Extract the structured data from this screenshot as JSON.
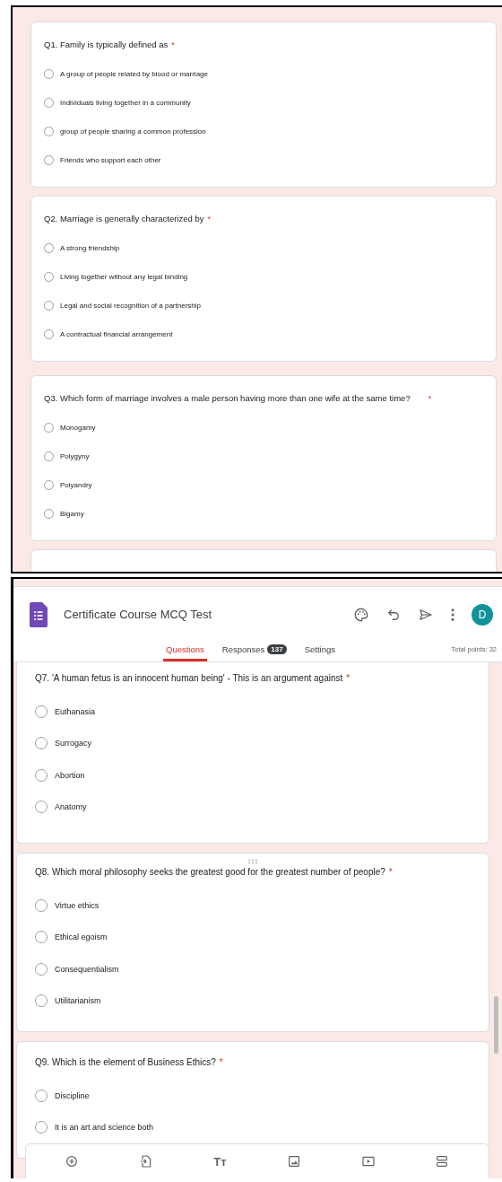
{
  "top_form": {
    "questions": [
      {
        "text": "Q1.  Family is typically defined as",
        "required_mark": "*",
        "options": [
          {
            "label": "A group of people related by blood or marriage",
            "selected": false
          },
          {
            "label": "Individuals living together in a community",
            "selected": false
          },
          {
            "label": "group of people sharing a common profession",
            "selected": false
          },
          {
            "label": "Friends who support each other",
            "selected": false
          }
        ]
      },
      {
        "text": "Q2.  Marriage is generally characterized by",
        "required_mark": "*",
        "options": [
          {
            "label": "A strong friendship",
            "selected": false
          },
          {
            "label": "Living together without any legal binding",
            "selected": false
          },
          {
            "label": "Legal and social recognition of a partnership",
            "selected": false
          },
          {
            "label": "A contractual financial arrangement",
            "selected": false
          }
        ]
      },
      {
        "text": "Q3.  Which form of marriage involves a male person having more than one wife at the same time?",
        "required_mark": "*",
        "options": [
          {
            "label": "Monogamy",
            "selected": false
          },
          {
            "label": "Polygyny",
            "selected": false
          },
          {
            "label": "Polyandry",
            "selected": false
          },
          {
            "label": "Bigamy",
            "selected": false
          }
        ]
      }
    ]
  },
  "editor": {
    "header": {
      "title": "Certificate Course MCQ Test",
      "avatar": "D"
    },
    "tabs": [
      {
        "label": "Questions",
        "selected": true
      },
      {
        "label": "Responses",
        "badge": "137",
        "selected": false
      },
      {
        "label": "Settings",
        "selected": false
      }
    ],
    "total_points": "Total points: 32",
    "questions": [
      {
        "text": "Q7. 'A human fetus is an innocent human being' - This is an argument against",
        "required_mark": "*",
        "drag_handle": false,
        "options": [
          {
            "label": "Euthanasia",
            "selected": false
          },
          {
            "label": "Surrogacy",
            "selected": false
          },
          {
            "label": "Abortion",
            "selected": false
          },
          {
            "label": "Anatomy",
            "selected": false
          }
        ]
      },
      {
        "text": "Q8. Which moral philosophy seeks the greatest good for the greatest number of people?",
        "required_mark": "*",
        "drag_handle": true,
        "options": [
          {
            "label": "Virtue ethics",
            "selected": false
          },
          {
            "label": "Ethical egoism",
            "selected": false
          },
          {
            "label": "Consequentialism",
            "selected": false
          },
          {
            "label": "Utilitarianism",
            "selected": false
          }
        ]
      },
      {
        "text": "Q9. Which is the element of Business Ethics?",
        "required_mark": "*",
        "drag_handle": false,
        "options": [
          {
            "label": "Discipline",
            "selected": false
          },
          {
            "label": "It is an art and science both",
            "selected": false
          }
        ]
      }
    ],
    "toolbar": [
      {
        "kind": "add"
      },
      {
        "kind": "import"
      },
      {
        "kind": "title",
        "glyph": "Tт"
      },
      {
        "kind": "image"
      },
      {
        "kind": "video"
      },
      {
        "kind": "section"
      }
    ]
  }
}
